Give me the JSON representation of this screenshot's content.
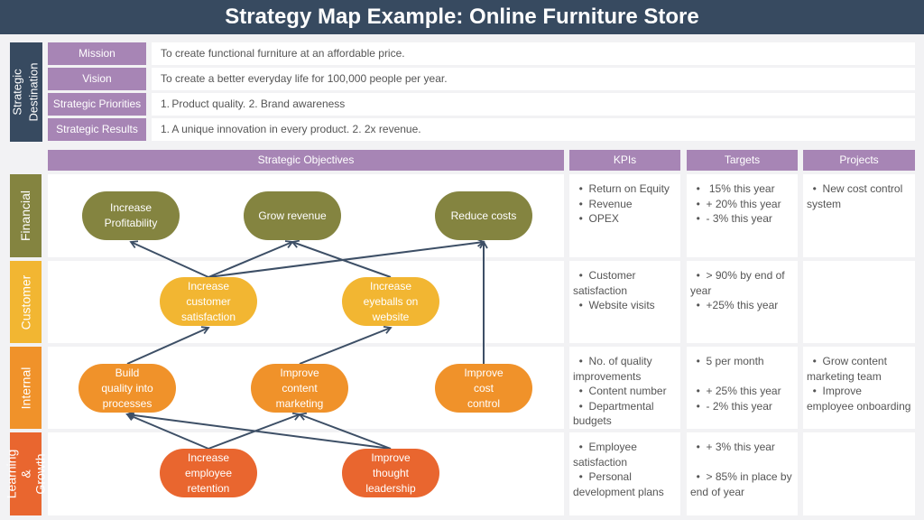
{
  "title": "Strategy Map Example: Online Furniture Store",
  "strategic_destination": {
    "side_label": [
      "Strategic",
      "Destination"
    ],
    "rows": [
      {
        "label": "Mission",
        "text": "To create functional furniture at an affordable price."
      },
      {
        "label": "Vision",
        "text": "To create a better everyday life for 100,000 people per year."
      },
      {
        "label": "Strategic Priorities",
        "text": "1. Product quality. 2. Brand awareness"
      },
      {
        "label": "Strategic Results",
        "text": "1. A unique innovation in every product.  2. 2x revenue."
      }
    ]
  },
  "columns": {
    "objectives": "Strategic Objectives",
    "kpis": "KPIs",
    "targets": "Targets",
    "projects": "Projects"
  },
  "colors": {
    "header": "#374a60",
    "purple": "#a785b5",
    "financial": "#848440",
    "customer": "#f2b632",
    "internal": "#f0922a",
    "learning": "#e9662f",
    "arrow": "#3d4f66"
  },
  "perspectives": [
    {
      "name": "Financial",
      "objectives": [
        "Increase\nProfitability",
        "Grow revenue",
        "Reduce costs"
      ],
      "kpis": [
        "Return on Equity",
        "Revenue",
        "OPEX"
      ],
      "targets": [
        " 15% this year",
        "+ 20% this year",
        "- 3% this year"
      ],
      "projects": [
        "New cost control system"
      ]
    },
    {
      "name": "Customer",
      "objectives": [
        "Increase\ncustomer\nsatisfaction",
        "Increase\neyeballs on\nwebsite"
      ],
      "kpis": [
        "Customer satisfaction",
        "Website visits"
      ],
      "targets": [
        "> 90% by end of year",
        "+25% this year"
      ],
      "projects": []
    },
    {
      "name": "Internal",
      "objectives": [
        "Build\nquality into\nprocesses",
        "Improve\ncontent\nmarketing",
        "Improve\ncost\ncontrol"
      ],
      "kpis": [
        "No. of quality improvements",
        "Content number",
        "Departmental budgets"
      ],
      "targets": [
        "5 per month",
        "",
        "+ 25% this year",
        "- 2% this year"
      ],
      "projects": [
        "Grow content marketing team",
        "Improve employee onboarding"
      ]
    },
    {
      "name": "Learning & Growth",
      "objectives": [
        "Increase\nemployee\nretention",
        "Improve\nthought\nleadership"
      ],
      "kpis": [
        "Employee satisfaction",
        "Personal development plans"
      ],
      "targets": [
        "+ 3% this year",
        "",
        ">  85%  in  place by end of year"
      ],
      "projects": []
    }
  ],
  "links": [
    {
      "from": "Increase customer satisfaction",
      "to": "Increase Profitability"
    },
    {
      "from": "Increase customer satisfaction",
      "to": "Grow revenue"
    },
    {
      "from": "Increase customer satisfaction",
      "to": "Reduce costs"
    },
    {
      "from": "Increase eyeballs on website",
      "to": "Grow revenue"
    },
    {
      "from": "Improve cost control",
      "to": "Reduce costs"
    },
    {
      "from": "Build quality into processes",
      "to": "Increase customer satisfaction"
    },
    {
      "from": "Improve content marketing",
      "to": "Increase eyeballs on website"
    },
    {
      "from": "Increase employee retention",
      "to": "Build quality into processes"
    },
    {
      "from": "Increase employee retention",
      "to": "Improve content marketing"
    },
    {
      "from": "Improve thought leadership",
      "to": "Build quality into processes"
    },
    {
      "from": "Improve thought leadership",
      "to": "Improve content marketing"
    }
  ]
}
